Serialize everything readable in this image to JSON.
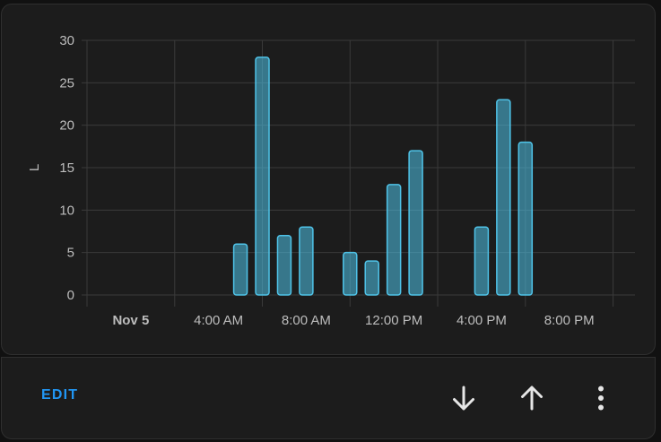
{
  "chart_data": {
    "type": "bar",
    "ylabel": "L",
    "ylim": [
      0,
      30
    ],
    "yticks": [
      0,
      5,
      10,
      15,
      20,
      25,
      30
    ],
    "xlim_hours": [
      0,
      25
    ],
    "xticks": [
      {
        "hour": 0,
        "label": "Nov 5",
        "bold": true
      },
      {
        "hour": 4,
        "label": "4:00 AM"
      },
      {
        "hour": 8,
        "label": "8:00 AM"
      },
      {
        "hour": 12,
        "label": "12:00 PM"
      },
      {
        "hour": 16,
        "label": "4:00 PM"
      },
      {
        "hour": 20,
        "label": "8:00 PM"
      }
    ],
    "x_hours": [
      7,
      8,
      9,
      10,
      12,
      13,
      14,
      15,
      18,
      19,
      20
    ],
    "values": [
      6,
      28,
      7,
      8,
      5,
      4,
      13,
      17,
      8,
      23,
      18
    ],
    "bar_color": "#4fc3e8",
    "grid": true
  },
  "footer": {
    "edit_label": "EDIT"
  }
}
